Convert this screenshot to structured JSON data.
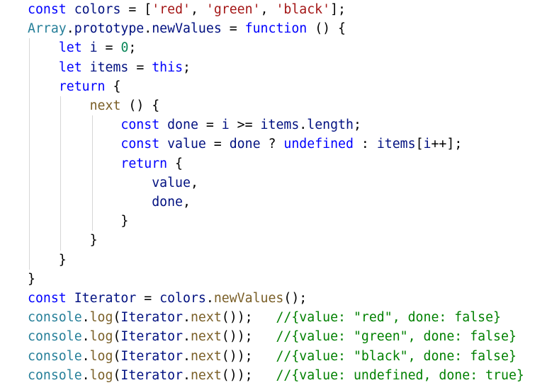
{
  "colors": {
    "keyword": "#0000ff",
    "identifier": "#001080",
    "type": "#267f99",
    "function": "#795e26",
    "string": "#a31515",
    "number": "#098658",
    "comment": "#008000",
    "plain": "#000000",
    "guide": "#d6d6d6",
    "background": "#ffffff"
  },
  "code": {
    "lines": [
      [
        {
          "t": "const",
          "c": "keyword"
        },
        {
          "t": " "
        },
        {
          "t": "colors",
          "c": "identifier"
        },
        {
          "t": " = ["
        },
        {
          "t": "'red'",
          "c": "string"
        },
        {
          "t": ", "
        },
        {
          "t": "'green'",
          "c": "string"
        },
        {
          "t": ", "
        },
        {
          "t": "'black'",
          "c": "string"
        },
        {
          "t": "];"
        }
      ],
      [
        {
          "t": "Array",
          "c": "type"
        },
        {
          "t": "."
        },
        {
          "t": "prototype",
          "c": "identifier"
        },
        {
          "t": "."
        },
        {
          "t": "newValues",
          "c": "identifier"
        },
        {
          "t": " = "
        },
        {
          "t": "function",
          "c": "keyword"
        },
        {
          "t": " () {"
        }
      ],
      [
        {
          "t": "    "
        },
        {
          "t": "let",
          "c": "keyword"
        },
        {
          "t": " "
        },
        {
          "t": "i",
          "c": "identifier"
        },
        {
          "t": " = "
        },
        {
          "t": "0",
          "c": "number"
        },
        {
          "t": ";"
        }
      ],
      [
        {
          "t": "    "
        },
        {
          "t": "let",
          "c": "keyword"
        },
        {
          "t": " "
        },
        {
          "t": "items",
          "c": "identifier"
        },
        {
          "t": " = "
        },
        {
          "t": "this",
          "c": "keyword"
        },
        {
          "t": ";"
        }
      ],
      [
        {
          "t": "    "
        },
        {
          "t": "return",
          "c": "keyword"
        },
        {
          "t": " {"
        }
      ],
      [
        {
          "t": "        "
        },
        {
          "t": "next",
          "c": "function"
        },
        {
          "t": " () {"
        }
      ],
      [
        {
          "t": "            "
        },
        {
          "t": "const",
          "c": "keyword"
        },
        {
          "t": " "
        },
        {
          "t": "done",
          "c": "identifier"
        },
        {
          "t": " = "
        },
        {
          "t": "i",
          "c": "identifier"
        },
        {
          "t": " >= "
        },
        {
          "t": "items",
          "c": "identifier"
        },
        {
          "t": "."
        },
        {
          "t": "length",
          "c": "identifier"
        },
        {
          "t": ";"
        }
      ],
      [
        {
          "t": "            "
        },
        {
          "t": "const",
          "c": "keyword"
        },
        {
          "t": " "
        },
        {
          "t": "value",
          "c": "identifier"
        },
        {
          "t": " = "
        },
        {
          "t": "done",
          "c": "identifier"
        },
        {
          "t": " ? "
        },
        {
          "t": "undefined",
          "c": "keyword"
        },
        {
          "t": " : "
        },
        {
          "t": "items",
          "c": "identifier"
        },
        {
          "t": "["
        },
        {
          "t": "i",
          "c": "identifier"
        },
        {
          "t": "++];"
        }
      ],
      [
        {
          "t": "            "
        },
        {
          "t": "return",
          "c": "keyword"
        },
        {
          "t": " {"
        }
      ],
      [
        {
          "t": "                "
        },
        {
          "t": "value",
          "c": "identifier"
        },
        {
          "t": ","
        }
      ],
      [
        {
          "t": "                "
        },
        {
          "t": "done",
          "c": "identifier"
        },
        {
          "t": ","
        }
      ],
      [
        {
          "t": "            }"
        }
      ],
      [
        {
          "t": "        }"
        }
      ],
      [
        {
          "t": "    }"
        }
      ],
      [
        {
          "t": "}"
        }
      ],
      [
        {
          "t": "const",
          "c": "keyword"
        },
        {
          "t": " "
        },
        {
          "t": "Iterator",
          "c": "identifier"
        },
        {
          "t": " = "
        },
        {
          "t": "colors",
          "c": "identifier"
        },
        {
          "t": "."
        },
        {
          "t": "newValues",
          "c": "function"
        },
        {
          "t": "();"
        }
      ],
      [
        {
          "t": "console",
          "c": "type"
        },
        {
          "t": "."
        },
        {
          "t": "log",
          "c": "function"
        },
        {
          "t": "("
        },
        {
          "t": "Iterator",
          "c": "identifier"
        },
        {
          "t": "."
        },
        {
          "t": "next",
          "c": "function"
        },
        {
          "t": "());   "
        },
        {
          "t": "//{value: \"red\", done: false}",
          "c": "comment"
        }
      ],
      [
        {
          "t": "console",
          "c": "type"
        },
        {
          "t": "."
        },
        {
          "t": "log",
          "c": "function"
        },
        {
          "t": "("
        },
        {
          "t": "Iterator",
          "c": "identifier"
        },
        {
          "t": "."
        },
        {
          "t": "next",
          "c": "function"
        },
        {
          "t": "());   "
        },
        {
          "t": "//{value: \"green\", done: false}",
          "c": "comment"
        }
      ],
      [
        {
          "t": "console",
          "c": "type"
        },
        {
          "t": "."
        },
        {
          "t": "log",
          "c": "function"
        },
        {
          "t": "("
        },
        {
          "t": "Iterator",
          "c": "identifier"
        },
        {
          "t": "."
        },
        {
          "t": "next",
          "c": "function"
        },
        {
          "t": "());   "
        },
        {
          "t": "//{value: \"black\", done: false}",
          "c": "comment"
        }
      ],
      [
        {
          "t": "console",
          "c": "type"
        },
        {
          "t": "."
        },
        {
          "t": "log",
          "c": "function"
        },
        {
          "t": "("
        },
        {
          "t": "Iterator",
          "c": "identifier"
        },
        {
          "t": "."
        },
        {
          "t": "next",
          "c": "function"
        },
        {
          "t": "());   "
        },
        {
          "t": "//{value: undefined, done: true}",
          "c": "comment"
        }
      ]
    ]
  }
}
